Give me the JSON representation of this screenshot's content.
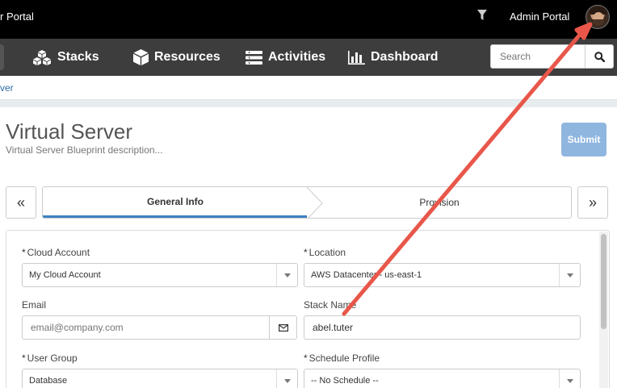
{
  "topbar": {
    "portal_title": "r Portal",
    "admin_portal_label": "Admin Portal",
    "icons": {
      "filter": "filter-icon",
      "avatar": "user-avatar"
    }
  },
  "navbar": {
    "items": [
      {
        "label": "Stacks",
        "icon": "cubes-icon"
      },
      {
        "label": "Resources",
        "icon": "cube-icon"
      },
      {
        "label": "Activities",
        "icon": "list-icon"
      },
      {
        "label": "Dashboard",
        "icon": "bar-chart-icon"
      }
    ],
    "search": {
      "placeholder": "Search",
      "button_icon": "search-icon"
    }
  },
  "breadcrumb": {
    "current": "ver"
  },
  "page": {
    "title": "Virtual Server",
    "description": "Virtual Server Blueprint description...",
    "submit_label": "Submit"
  },
  "wizard": {
    "prev_label": "«",
    "next_label": "»",
    "steps": [
      {
        "label": "General Info",
        "active": true
      },
      {
        "label": "Provision",
        "active": false
      }
    ]
  },
  "form": {
    "cloud_account": {
      "label": "Cloud Account",
      "required": "*",
      "value": "My Cloud Account"
    },
    "location": {
      "label": "Location",
      "required": "*",
      "value": "AWS Datacenter - us-east-1"
    },
    "email": {
      "label": "Email",
      "placeholder": "email@company.com",
      "icon": "envelope-icon"
    },
    "stack_name": {
      "label": "Stack Name",
      "value": "abel.tuter"
    },
    "user_group": {
      "label": "User Group",
      "required": "*",
      "value": "Database"
    },
    "schedule_profile": {
      "label": "Schedule Profile",
      "required": "*",
      "value": "-- No Schedule --"
    }
  },
  "colors": {
    "topbar_bg": "#000000",
    "navbar_bg": "#3d3d3d",
    "accent_blue": "#3b82c4",
    "submit_bg": "#8fb6df",
    "annotation_arrow": "#e8574a"
  }
}
